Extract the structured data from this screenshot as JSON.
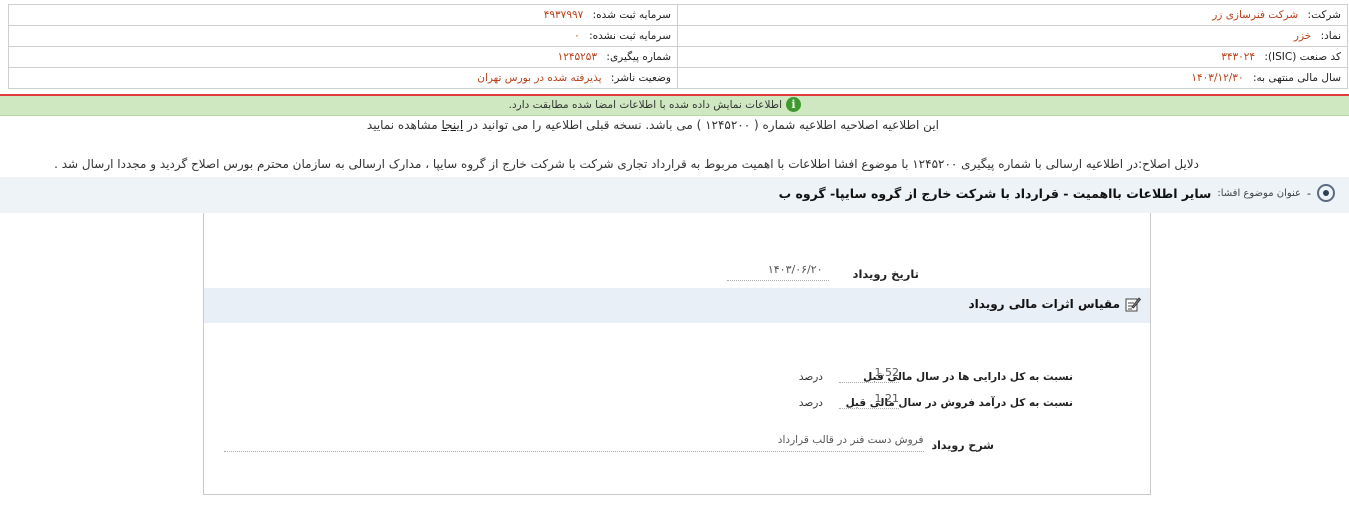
{
  "header": {
    "company_label": "شرکت:",
    "company_value": "شرکت فنرسازی زر",
    "registered_capital_label": "سرمایه ثبت شده:",
    "registered_capital_value": "۴۹۳۷۹۹۷",
    "symbol_label": "نماد:",
    "symbol_value": "خزر",
    "unregistered_capital_label": "سرمایه ثبت نشده:",
    "unregistered_capital_value": "۰",
    "isic_label": "کد صنعت (ISIC):",
    "isic_value": "۳۴۳۰۲۴",
    "tracking_label": "شماره پیگیری:",
    "tracking_value": "۱۲۴۵۲۵۳",
    "fiscal_year_label": "سال مالی منتهی به:",
    "fiscal_year_value": "۱۴۰۳/۱۲/۳۰",
    "publisher_status_label": "وضعیت ناشر:",
    "publisher_status_value": "پذیرفته شده در بورس تهران"
  },
  "info_bar": {
    "text": "اطلاعات نمایش داده شده با اطلاعات امضا شده مطابقت دارد.",
    "icon": "info-icon"
  },
  "notice": {
    "text_before": "این اطلاعیه اصلاحیه اطلاعیه شماره ( ۱۲۴۵۲۰۰ ) می باشد. نسخه قبلی اطلاعیه را می توانید در",
    "link": "اینجا",
    "text_after": "مشاهده نمایید"
  },
  "reasons": {
    "text": "دلایل اصلاح:در اطلاعیه ارسالی با شماره پیگیری ۱۲۴۵۲۰۰ با موضوع افشا اطلاعات با اهمیت مربوط به قرارداد تجاری شرکت با شرکت خارج از گروه سایپا ، مدارک ارسالی به سازمان محترم بورس اصلاح گردید و مجددا ارسال شد ."
  },
  "subject": {
    "label": "عنوان موضوع افشا:",
    "value": "سایر اطلاعات بااهمیت - قرارداد با شرکت خارج از گروه سایپا- گروه ب"
  },
  "event": {
    "date_label": "تاریخ رویداد",
    "date_value": "۱۴۰۳/۰۶/۲۰"
  },
  "financial_section": {
    "title": "مقیاس اثرات مالی رویداد",
    "assets_label": "نسبت به کل دارایی ها در سال مالی قبل",
    "assets_value": "1.52",
    "assets_unit": "درصد",
    "revenue_label": "نسبت به کل درآمد فروش در سال مالی قبل",
    "revenue_value": "1.21",
    "revenue_unit": "درصد",
    "description_label": "شرح رویداد",
    "description_value": "فروش دست فنر در قالب قرارداد"
  }
}
